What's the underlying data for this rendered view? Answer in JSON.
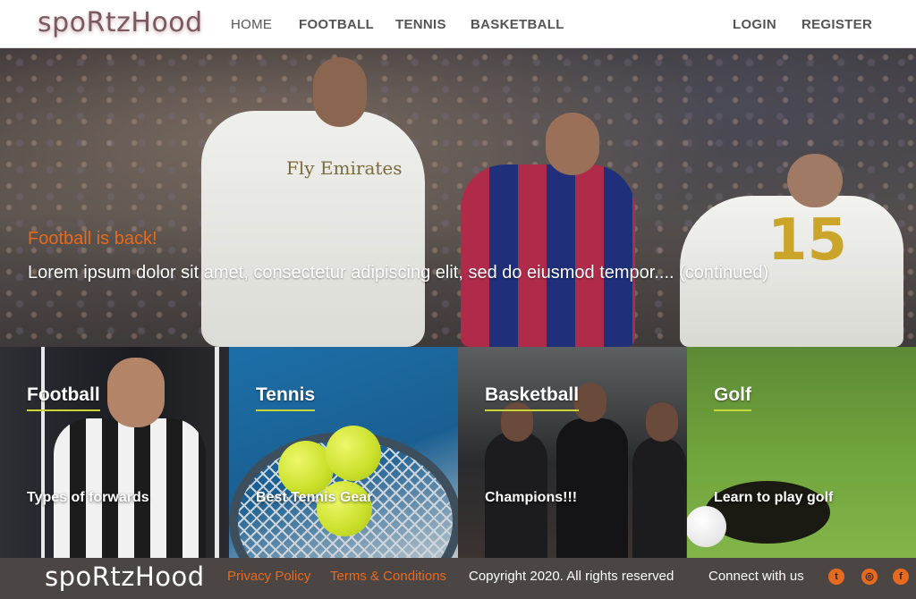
{
  "header": {
    "brand": "spoRtzHood",
    "nav": {
      "home": "HOME",
      "football": "FOOTBALL",
      "tennis": "TENNIS",
      "basketball": "BASKETBALL",
      "login": "LOGIN",
      "register": "REGISTER"
    }
  },
  "hero": {
    "kicker": "Football is back!",
    "text": "Lorem ipsum dolor sit amet, consectetur adipiscing elit, sed do eiusmod tempor.... (continued)",
    "jersey_number": "15",
    "jersey_sponsor": "Fly Emirates"
  },
  "cards": [
    {
      "title": "Football",
      "subtitle": "Types of forwards"
    },
    {
      "title": "Tennis",
      "subtitle": "Best Tennis Gear"
    },
    {
      "title": "Basketball",
      "subtitle": "Champions!!!"
    },
    {
      "title": "Golf",
      "subtitle": "Learn to play golf"
    }
  ],
  "footer": {
    "brand": "spoRtzHood",
    "privacy": "Privacy Policy",
    "terms": "Terms & Conditions",
    "copyright": "Copyright 2020. All rights reserved",
    "connect": "Connect with us",
    "social": {
      "twitter": "t",
      "instagram": "◎",
      "facebook": "f"
    }
  },
  "colors": {
    "accent": "#e86a1e",
    "underline": "#c6d63a",
    "footer_bg": "#4b4543"
  }
}
